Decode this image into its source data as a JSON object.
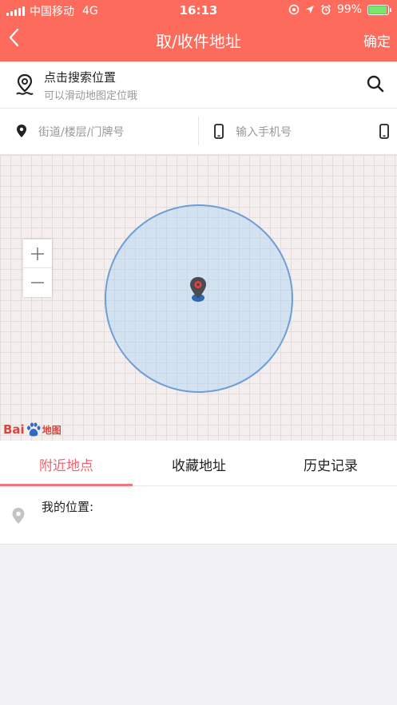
{
  "status_bar": {
    "carrier": "中国移动",
    "network": "4G",
    "time": "16:13",
    "battery": "99%"
  },
  "nav": {
    "title": "取/收件地址",
    "confirm": "确定",
    "back_icon": "chevron-left-icon"
  },
  "search": {
    "title": "点击搜索位置",
    "hint": "可以滑动地图定位哦"
  },
  "inputs": {
    "address_placeholder": "街道/楼层/门牌号",
    "phone_placeholder": "输入手机号"
  },
  "map": {
    "logo_text_1": "Bai",
    "logo_text_2": "地图"
  },
  "tabs": [
    {
      "label": "附近地点",
      "active": true
    },
    {
      "label": "收藏地址",
      "active": false
    },
    {
      "label": "历史记录",
      "active": false
    }
  ],
  "list": [
    {
      "label": "我的位置:"
    }
  ],
  "colors": {
    "header": "#fc6b5b",
    "tab_active": "#f0636f",
    "accuracy_circle": "#6d9ed4",
    "pin_red": "#e0443a"
  }
}
